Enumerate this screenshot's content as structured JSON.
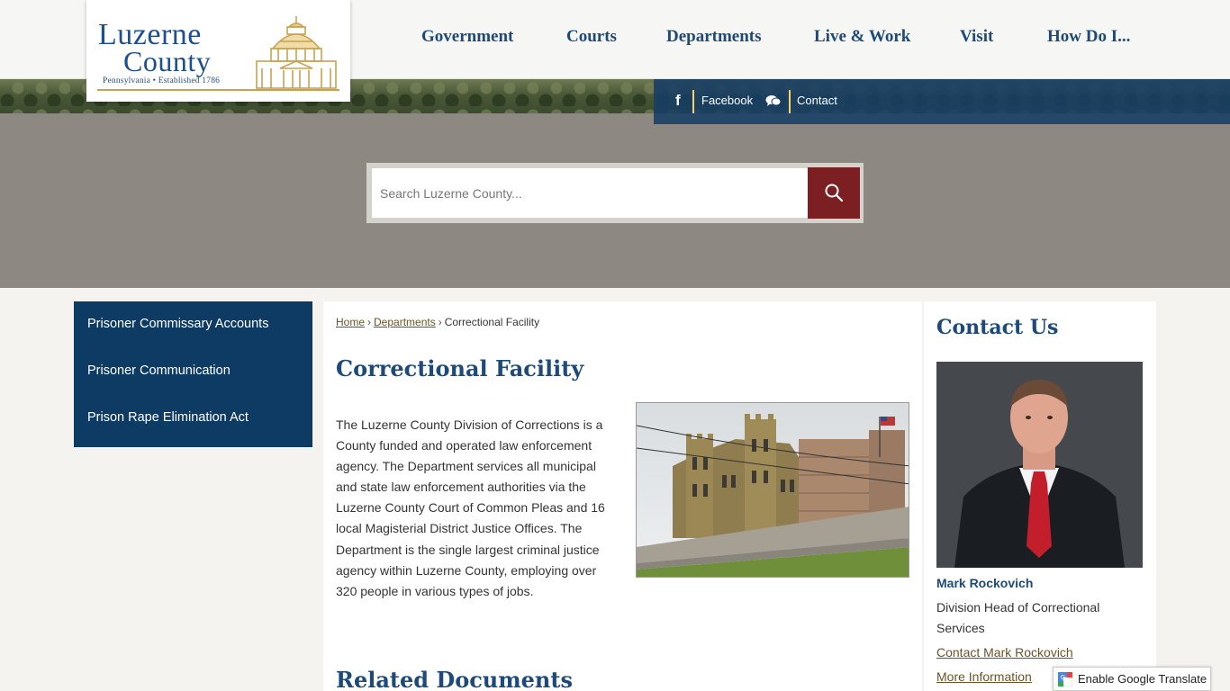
{
  "logo": {
    "line1": "Luzerne",
    "line2": "County",
    "tagline": "Pennsylvania • Established 1786"
  },
  "nav": {
    "items": [
      "Government",
      "Courts",
      "Departments",
      "Live & Work",
      "Visit",
      "How Do I..."
    ]
  },
  "social": {
    "facebook_label": "Facebook",
    "contact_label": "Contact"
  },
  "search": {
    "placeholder": "Search Luzerne County..."
  },
  "sidebar": {
    "items": [
      "Prisoner Commissary Accounts",
      "Prisoner Communication",
      "Prison Rape Elimination Act"
    ]
  },
  "breadcrumb": {
    "home": "Home",
    "departments": "Departments",
    "current": "Correctional Facility"
  },
  "main": {
    "title": "Correctional Facility",
    "body": "The Luzerne County Division of Corrections is a County funded and operated law enforcement agency. The Department services all municipal and state law enforcement authorities via the Luzerne County Court of Common Pleas and 16 local Magisterial District Justice Offices. The Department is the single largest criminal justice agency within Luzerne County, employing over 320 people in various types of jobs.",
    "related_heading": "Related Documents"
  },
  "contact": {
    "title": "Contact Us",
    "name": "Mark Rockovich",
    "role": "Division Head of Correctional Services",
    "contact_link": "Contact Mark Rockovich",
    "more_link": "More Information"
  },
  "translate": {
    "label": "Enable Google Translate"
  },
  "colors": {
    "navy": "#0d3b63",
    "nav_text": "#1e4a79",
    "search_button": "#7b1f23",
    "accent_gold": "#c7a253"
  }
}
